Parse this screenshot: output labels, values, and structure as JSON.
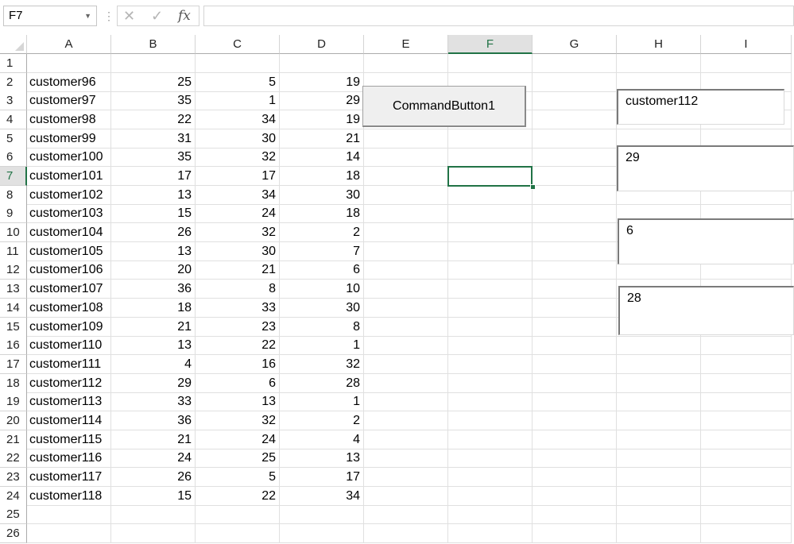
{
  "formula_bar": {
    "name_box": "F7",
    "cancel_icon": "✕",
    "enter_icon": "✓",
    "fx_label": "fx",
    "formula": ""
  },
  "columns": [
    "A",
    "B",
    "C",
    "D",
    "E",
    "F",
    "G",
    "H",
    "I"
  ],
  "active_cell": "F7",
  "rows": [
    {
      "n": "1",
      "a": "",
      "b": "",
      "c": "",
      "d": ""
    },
    {
      "n": "2",
      "a": "customer96",
      "b": "25",
      "c": "5",
      "d": "19"
    },
    {
      "n": "3",
      "a": "customer97",
      "b": "35",
      "c": "1",
      "d": "29"
    },
    {
      "n": "4",
      "a": "customer98",
      "b": "22",
      "c": "34",
      "d": "19"
    },
    {
      "n": "5",
      "a": "customer99",
      "b": "31",
      "c": "30",
      "d": "21"
    },
    {
      "n": "6",
      "a": "customer100",
      "b": "35",
      "c": "32",
      "d": "14"
    },
    {
      "n": "7",
      "a": "customer101",
      "b": "17",
      "c": "17",
      "d": "18"
    },
    {
      "n": "8",
      "a": "customer102",
      "b": "13",
      "c": "34",
      "d": "30"
    },
    {
      "n": "9",
      "a": "customer103",
      "b": "15",
      "c": "24",
      "d": "18"
    },
    {
      "n": "10",
      "a": "customer104",
      "b": "26",
      "c": "32",
      "d": "2"
    },
    {
      "n": "11",
      "a": "customer105",
      "b": "13",
      "c": "30",
      "d": "7"
    },
    {
      "n": "12",
      "a": "customer106",
      "b": "20",
      "c": "21",
      "d": "6"
    },
    {
      "n": "13",
      "a": "customer107",
      "b": "36",
      "c": "8",
      "d": "10"
    },
    {
      "n": "14",
      "a": "customer108",
      "b": "18",
      "c": "33",
      "d": "30"
    },
    {
      "n": "15",
      "a": "customer109",
      "b": "21",
      "c": "23",
      "d": "8"
    },
    {
      "n": "16",
      "a": "customer110",
      "b": "13",
      "c": "22",
      "d": "1"
    },
    {
      "n": "17",
      "a": "customer111",
      "b": "4",
      "c": "16",
      "d": "32"
    },
    {
      "n": "18",
      "a": "customer112",
      "b": "29",
      "c": "6",
      "d": "28"
    },
    {
      "n": "19",
      "a": "customer113",
      "b": "33",
      "c": "13",
      "d": "1"
    },
    {
      "n": "20",
      "a": "customer114",
      "b": "36",
      "c": "32",
      "d": "2"
    },
    {
      "n": "21",
      "a": "customer115",
      "b": "21",
      "c": "24",
      "d": "4"
    },
    {
      "n": "22",
      "a": "customer116",
      "b": "24",
      "c": "25",
      "d": "13"
    },
    {
      "n": "23",
      "a": "customer117",
      "b": "26",
      "c": "5",
      "d": "17"
    },
    {
      "n": "24",
      "a": "customer118",
      "b": "15",
      "c": "22",
      "d": "34"
    },
    {
      "n": "25",
      "a": "",
      "b": "",
      "c": "",
      "d": ""
    },
    {
      "n": "26",
      "a": "",
      "b": "",
      "c": "",
      "d": ""
    }
  ],
  "controls": {
    "command_button": "CommandButton1",
    "textboxes": [
      "customer112",
      "29",
      "6",
      "28"
    ]
  }
}
